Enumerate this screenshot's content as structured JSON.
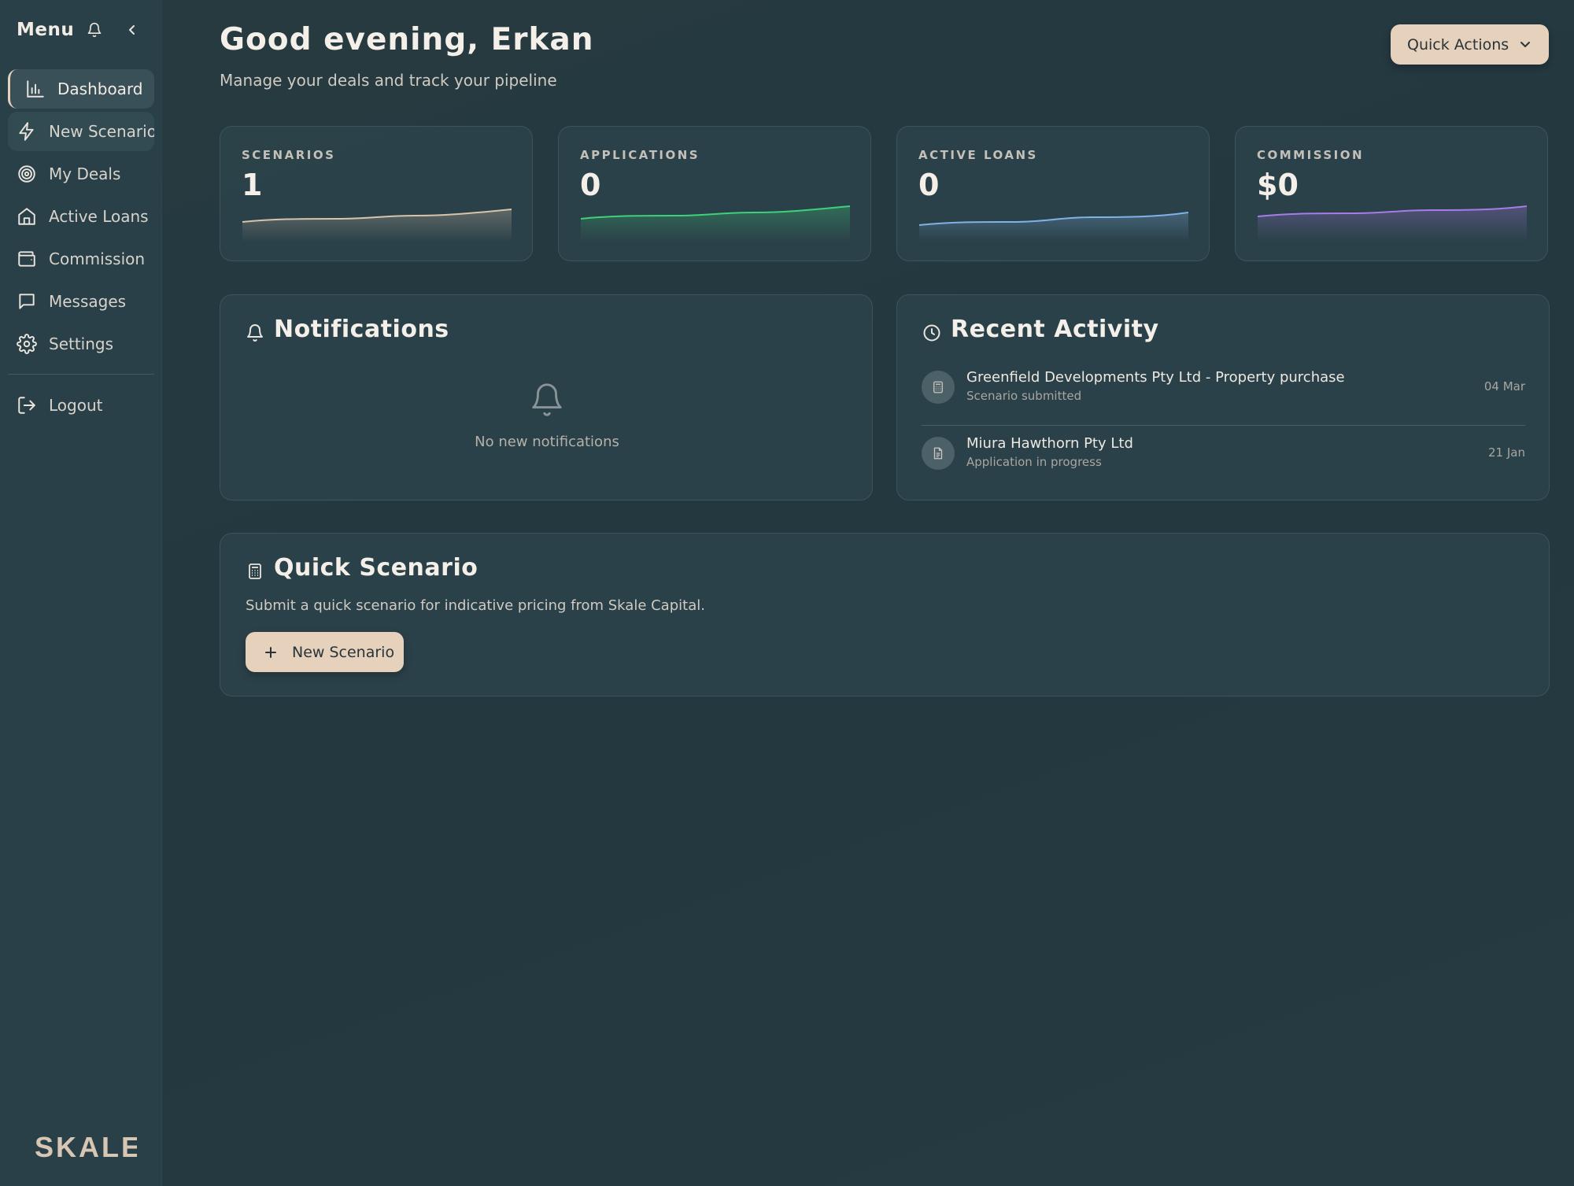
{
  "sidebar": {
    "title": "Menu",
    "items": [
      {
        "label": "Dashboard",
        "icon": "bar-chart-icon"
      },
      {
        "label": "New Scenario",
        "icon": "lightning-icon"
      },
      {
        "label": "My Deals",
        "icon": "target-icon"
      },
      {
        "label": "Active Loans",
        "icon": "home-icon"
      },
      {
        "label": "Commission",
        "icon": "wallet-icon"
      },
      {
        "label": "Messages",
        "icon": "message-icon"
      },
      {
        "label": "Settings",
        "icon": "gear-icon"
      }
    ],
    "logout_label": "Logout",
    "logo_text": "SKALE"
  },
  "header": {
    "greeting": "Good evening, Erkan",
    "subtitle": "Manage your deals and track your pipeline",
    "quick_actions_label": "Quick Actions"
  },
  "stats": [
    {
      "label": "SCENARIOS",
      "value": "1",
      "color": "#d8c3ac"
    },
    {
      "label": "APPLICATIONS",
      "value": "0",
      "color": "#3ed17a"
    },
    {
      "label": "ACTIVE LOANS",
      "value": "0",
      "color": "#7fb2e6"
    },
    {
      "label": "COMMISSION",
      "value": "$0",
      "color": "#a77be8"
    }
  ],
  "notifications": {
    "title": "Notifications",
    "empty_text": "No new notifications"
  },
  "activity": {
    "title": "Recent Activity",
    "items": [
      {
        "title": "Greenfield Developments Pty Ltd - Property purchase",
        "subtitle": "Scenario submitted",
        "date": "04 Mar",
        "icon": "calculator-icon"
      },
      {
        "title": "Miura Hawthorn Pty Ltd",
        "subtitle": "Application in progress",
        "date": "21 Jan",
        "icon": "document-icon"
      }
    ]
  },
  "quick_scenario": {
    "title": "Quick Scenario",
    "description": "Submit a quick scenario for indicative pricing from Skale Capital.",
    "button_label": "New Scenario"
  },
  "colors": {
    "accent": "#e6d1bd",
    "background": "#263a40",
    "sidebar": "#2a4048"
  }
}
